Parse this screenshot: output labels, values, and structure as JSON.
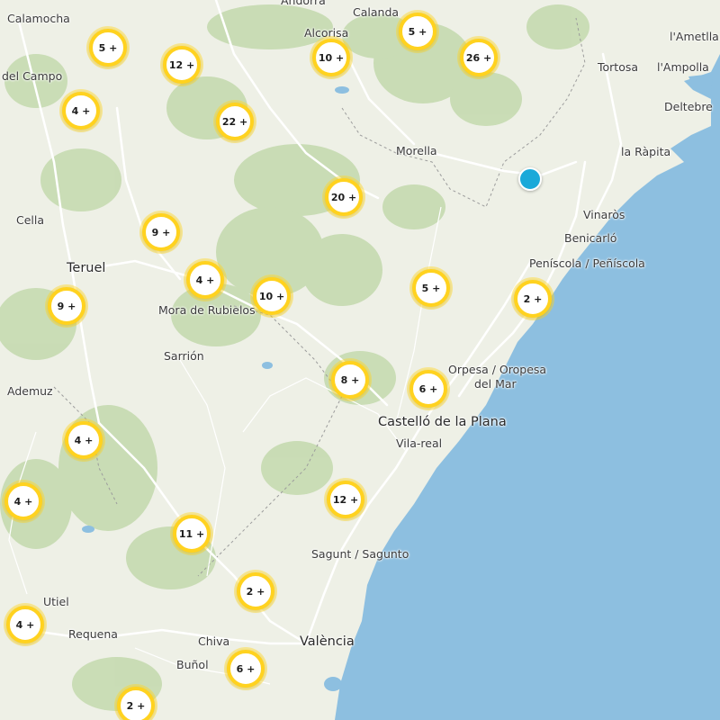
{
  "map": {
    "colors": {
      "land": "#eef0e6",
      "forest": "#c3d9ad",
      "sea": "#8dbfe0",
      "road": "#ffffff",
      "cluster_border": "#ffd21f",
      "point_marker": "#1aa9d9"
    },
    "places": [
      {
        "id": "andorra",
        "name": "Andorra"
      },
      {
        "id": "calamocha",
        "name": "Calamocha"
      },
      {
        "id": "calanda",
        "name": "Calanda"
      },
      {
        "id": "alcorisa",
        "name": "Alcorisa"
      },
      {
        "id": "lametlla",
        "name": "l'Ametlla"
      },
      {
        "id": "del-campo",
        "name": "del Campo"
      },
      {
        "id": "tortosa",
        "name": "Tortosa"
      },
      {
        "id": "lampolla",
        "name": "l'Ampolla"
      },
      {
        "id": "deltebre",
        "name": "Deltebre"
      },
      {
        "id": "morella",
        "name": "Morella"
      },
      {
        "id": "la-rapita",
        "name": "la Ràpita"
      },
      {
        "id": "cella",
        "name": "Cella"
      },
      {
        "id": "vinaros",
        "name": "Vinaròs"
      },
      {
        "id": "benicarlo",
        "name": "Benicarló"
      },
      {
        "id": "teruel",
        "name": "Teruel"
      },
      {
        "id": "peniscola",
        "name": "Peníscola / Peñíscola"
      },
      {
        "id": "mora-de-rubielos",
        "name": "Mora de Rubielos"
      },
      {
        "id": "sarrion",
        "name": "Sarrión"
      },
      {
        "id": "oropesa-1",
        "name": "Orpesa / Oropesa"
      },
      {
        "id": "oropesa-2",
        "name": "del Mar"
      },
      {
        "id": "ademuz",
        "name": "Ademuz"
      },
      {
        "id": "castello",
        "name": "Castelló de la Plana"
      },
      {
        "id": "vila-real",
        "name": "Vila-real"
      },
      {
        "id": "sagunt",
        "name": "Sagunt / Sagunto"
      },
      {
        "id": "utiel",
        "name": "Utiel"
      },
      {
        "id": "requena",
        "name": "Requena"
      },
      {
        "id": "chiva",
        "name": "Chiva"
      },
      {
        "id": "valencia",
        "name": "València"
      },
      {
        "id": "bunol",
        "name": "Buñol"
      }
    ],
    "clusters": [
      {
        "id": "c01",
        "count": "5 +"
      },
      {
        "id": "c02",
        "count": "12 +"
      },
      {
        "id": "c03",
        "count": "10 +"
      },
      {
        "id": "c04",
        "count": "5 +"
      },
      {
        "id": "c05",
        "count": "26 +"
      },
      {
        "id": "c06",
        "count": "4 +"
      },
      {
        "id": "c07",
        "count": "22 +"
      },
      {
        "id": "c08",
        "count": "20 +"
      },
      {
        "id": "c09",
        "count": "9 +"
      },
      {
        "id": "c10",
        "count": "4 +"
      },
      {
        "id": "c11",
        "count": "10 +"
      },
      {
        "id": "c12",
        "count": "9 +"
      },
      {
        "id": "c13",
        "count": "5 +"
      },
      {
        "id": "c14",
        "count": "2 +"
      },
      {
        "id": "c15",
        "count": "8 +"
      },
      {
        "id": "c16",
        "count": "6 +"
      },
      {
        "id": "c17",
        "count": "4 +"
      },
      {
        "id": "c18",
        "count": "4 +"
      },
      {
        "id": "c19",
        "count": "12 +"
      },
      {
        "id": "c20",
        "count": "11 +"
      },
      {
        "id": "c21",
        "count": "2 +"
      },
      {
        "id": "c22",
        "count": "4 +"
      },
      {
        "id": "c23",
        "count": "6 +"
      },
      {
        "id": "c24",
        "count": "2 +"
      }
    ]
  }
}
